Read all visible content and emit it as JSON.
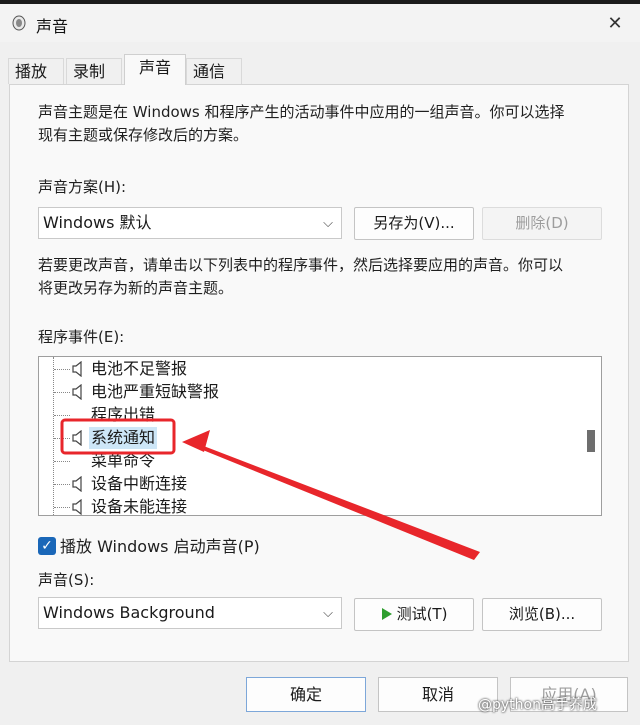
{
  "window": {
    "title": "声音",
    "close_glyph": "✕"
  },
  "tabs": [
    {
      "label": "播放"
    },
    {
      "label": "录制"
    },
    {
      "label": "声音",
      "active": true
    },
    {
      "label": "通信"
    }
  ],
  "intro_text_line1": "声音主题是在 Windows 和程序产生的活动事件中应用的一组声音。你可以选择",
  "intro_text_line2": "现有主题或保存修改后的方案。",
  "scheme": {
    "label": "声音方案(H):",
    "value": "Windows 默认",
    "save_as_label": "另存为(V)...",
    "delete_label": "删除(D)"
  },
  "change_text_line1": "若要更改声音，请单击以下列表中的程序事件，然后选择要应用的声音。你可以",
  "change_text_line2": "将更改另存为新的声音主题。",
  "events": {
    "label": "程序事件(E):",
    "items": [
      {
        "label": "电池不足警报",
        "has_sound": true
      },
      {
        "label": "电池严重短缺警报",
        "has_sound": true
      },
      {
        "label": "程序出错",
        "has_sound": false
      },
      {
        "label": "系统通知",
        "has_sound": true,
        "selected": true
      },
      {
        "label": "菜单命令",
        "has_sound": false
      },
      {
        "label": "设备中断连接",
        "has_sound": true
      },
      {
        "label": "设备未能连接",
        "has_sound": true
      }
    ]
  },
  "startup_sound": {
    "checked": true,
    "label": "播放 Windows 启动声音(P)"
  },
  "sound": {
    "label": "声音(S):",
    "value": "Windows Background",
    "test_label": "测试(T)",
    "browse_label": "浏览(B)..."
  },
  "footer": {
    "ok_label": "确定",
    "cancel_label": "取消",
    "apply_label": "应用(A)"
  },
  "watermark": "@python高手养成",
  "colors": {
    "accent": "#1a67b8",
    "selection": "#cde6f7",
    "annotation_red": "#e8262b",
    "play_green": "#2e9e2e"
  },
  "icons": [
    "speaker-icon",
    "close-icon",
    "chevron-down-icon",
    "play-icon",
    "checkmark-icon"
  ]
}
